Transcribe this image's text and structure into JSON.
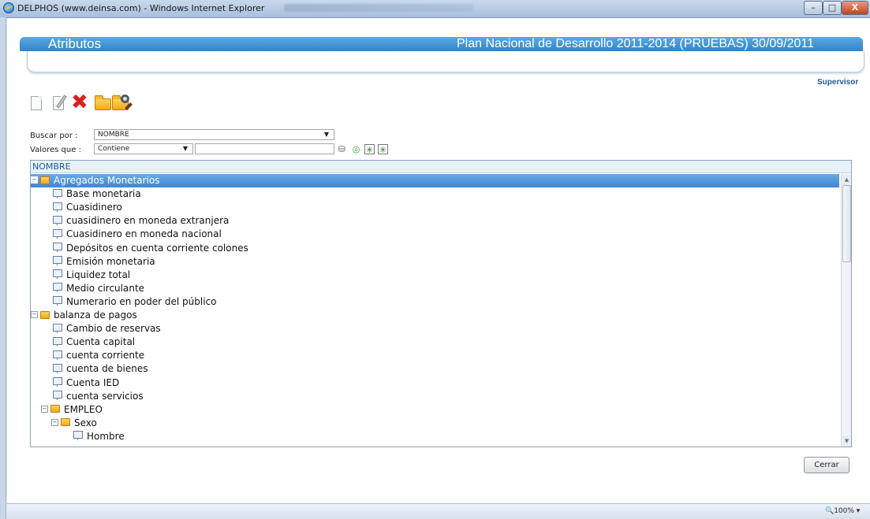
{
  "window": {
    "title": "DELPHOS (www.deinsa.com) - Windows Internet Explorer",
    "controls": {
      "minimize": "–",
      "maximize": "□",
      "close": "X"
    }
  },
  "header": {
    "left_title": "Atributos",
    "right_title": "Plan Nacional de Desarrollo 2011-2014 (PRUEBAS) 30/09/2011"
  },
  "user": {
    "role": "Supervisor"
  },
  "toolbar": [
    {
      "name": "new-document-icon"
    },
    {
      "name": "edit-icon"
    },
    {
      "name": "delete-icon",
      "glyph": "✖"
    },
    {
      "name": "open-folder-icon"
    },
    {
      "name": "search-icon"
    }
  ],
  "search": {
    "buscar_label": "Buscar por :",
    "buscar_value": "NOMBRE",
    "valores_label": "Valores que :",
    "valores_value": "Contiene",
    "text_value": "",
    "arrow": "▼"
  },
  "search_icons": [
    {
      "name": "binoculars-icon",
      "glyph": "⛁"
    },
    {
      "name": "refresh-icon",
      "glyph": "◎"
    },
    {
      "name": "expand-all-icon",
      "glyph": "✳"
    },
    {
      "name": "collapse-all-icon",
      "glyph": "✳"
    }
  ],
  "tree": {
    "column_header": "NOMBRE",
    "rows": [
      {
        "text": "Agregados Monetarios",
        "type": "folder",
        "level": 0,
        "toggle": "−",
        "selected": true
      },
      {
        "text": "Base monetaria",
        "type": "leaf",
        "level": 1
      },
      {
        "text": "Cuasidinero",
        "type": "leaf",
        "level": 1
      },
      {
        "text": "cuasidinero en moneda extranjera",
        "type": "leaf",
        "level": 1
      },
      {
        "text": "Cuasidinero en moneda nacional",
        "type": "leaf",
        "level": 1
      },
      {
        "text": "Depósitos en cuenta corriente colones",
        "type": "leaf",
        "level": 1
      },
      {
        "text": "Emisión monetaria",
        "type": "leaf",
        "level": 1
      },
      {
        "text": "Liquidez total",
        "type": "leaf",
        "level": 1
      },
      {
        "text": "Medio circulante",
        "type": "leaf",
        "level": 1
      },
      {
        "text": "Numerario en poder del público",
        "type": "leaf",
        "level": 1
      },
      {
        "text": "balanza de pagos",
        "type": "folder",
        "level": 0,
        "toggle": "−"
      },
      {
        "text": "Cambio de reservas",
        "type": "leaf",
        "level": 1
      },
      {
        "text": "Cuenta capital",
        "type": "leaf",
        "level": 1
      },
      {
        "text": "cuenta corriente",
        "type": "leaf",
        "level": 1
      },
      {
        "text": "cuenta de bienes",
        "type": "leaf",
        "level": 1
      },
      {
        "text": "Cuenta IED",
        "type": "leaf",
        "level": 1
      },
      {
        "text": "cuenta servicios",
        "type": "leaf",
        "level": 1
      },
      {
        "text": "EMPLEO",
        "type": "folder",
        "level": 1,
        "toggle": "−"
      },
      {
        "text": "Sexo",
        "type": "folder",
        "level": 2,
        "toggle": "−"
      },
      {
        "text": "Hombre",
        "type": "leaf",
        "level": 3
      }
    ]
  },
  "scrollbar": {
    "up": "▲",
    "down": "▼"
  },
  "buttons": {
    "close": "Cerrar"
  },
  "status": {
    "zoom": "🔍100%  ▾"
  },
  "colors": {
    "accent": "#2e86cc",
    "selection": "#3f86d3",
    "link": "#1e5c9e"
  }
}
